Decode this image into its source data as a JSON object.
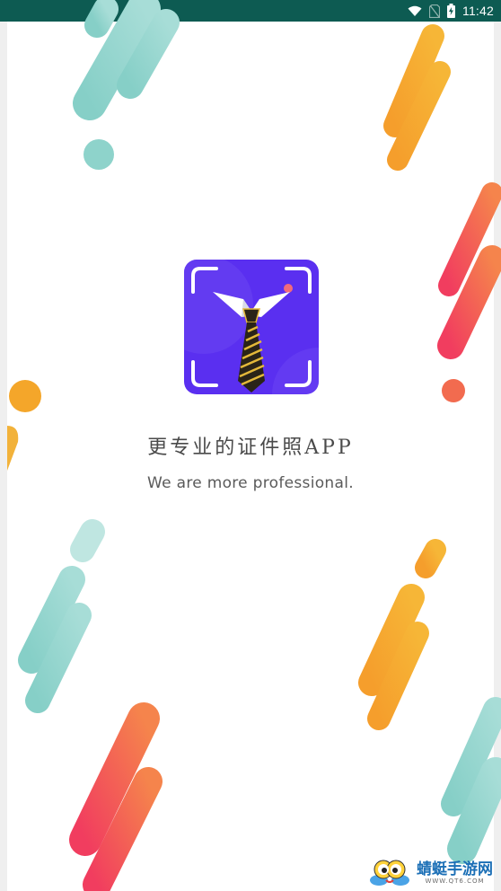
{
  "status_bar": {
    "time": "11:42",
    "icons": [
      "wifi-icon",
      "no-sim-icon",
      "battery-charging-icon"
    ],
    "background": "#0d5b52"
  },
  "splash": {
    "title": "更专业的证件照APP",
    "subtitle": "We are more professional.",
    "logo_icon": "tie-collar-icon",
    "logo_color": "#5b2cf0"
  },
  "watermark": {
    "text": "蜻蜓手游网",
    "sub": "WWW.QT6.COM"
  },
  "colors": {
    "teal": "#8fd4cc",
    "orange": "#f4a62a",
    "red": "#f24d5c",
    "accent_red": "#f26a4e"
  }
}
